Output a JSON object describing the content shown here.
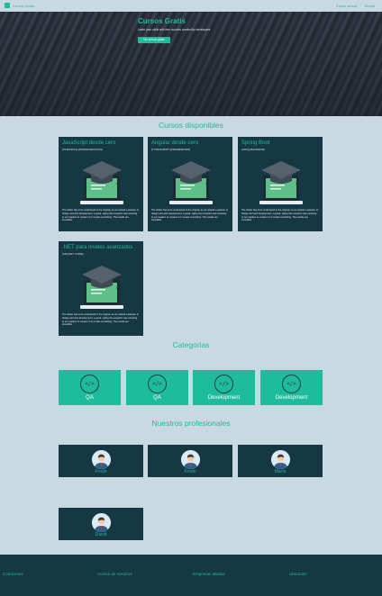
{
  "header": {
    "brand": "Cursos Gratis",
    "nav": [
      "Iniciar sesión",
      "Ebook"
    ]
  },
  "hero": {
    "title": "Cursos Gratis",
    "subtitle": "Learn your skills with free courses created by developers",
    "button": "Ver cursos gratis"
  },
  "sections": {
    "courses": "Cursos disponibles",
    "categories": "Categorias",
    "professionals": "Nuestros profesionales"
  },
  "courses": [
    {
      "title": "JavaScript desde cero",
      "meta": "[JS BASICS] [PROGRAMACION]",
      "description": "The Globe has to be understood in the original, as we started a passion of design and web development, a great, ogling the reception was amazing to our readers to create it is to create something. The results are incredible."
    },
    {
      "title": "Angular desde cero",
      "meta": "[TYPESCRIPT] [FRAMEWORK]",
      "description": "The Globe has to be understood in the original, as we started a passion of design and web development, a great, ogling the reception was amazing to our readers to create it is to create something. The results are incredible."
    },
    {
      "title": "Spring Boot",
      "meta": "[JAVA] [BACKEND]",
      "description": "The Globe has to be understood in the original, as we started a passion of design and web development, a great, ogling the reception was amazing to our readers to create it is to create something. The results are incredible."
    },
    {
      "title": ".NET para niveles avanzados",
      "meta": "[C#] [NET CORE]",
      "description": "The Globe has to be understood in the original, as we started a passion of design and web development, a great, ogling the reception was amazing to our readers to create it is to create something. The results are incredible."
    }
  ],
  "categories": [
    {
      "label": "QA",
      "icon": "code-icon",
      "glyph": "</>"
    },
    {
      "label": "QA",
      "icon": "code-icon",
      "glyph": "</>"
    },
    {
      "label": "Development",
      "icon": "code-icon",
      "glyph": "</>"
    },
    {
      "label": "Development",
      "icon": "code-icon",
      "glyph": "</>"
    }
  ],
  "professionals": [
    {
      "name": "Frodo"
    },
    {
      "name": "Frodo"
    },
    {
      "name": "María"
    },
    {
      "name": "David"
    }
  ],
  "footer": [
    "Conócenos",
    "Acerca de nosotros",
    "Empresas aliadas",
    "Ubicación"
  ],
  "colors": {
    "accent": "#1ebc9c",
    "background": "#c9d9e1",
    "card": "#163744"
  }
}
